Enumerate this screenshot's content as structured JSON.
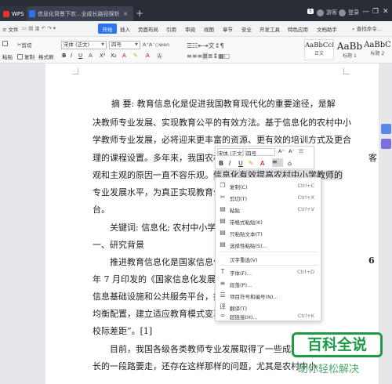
{
  "titlebar": {
    "app_tab": "WPS",
    "doc_tab": "信息化背景下农...业成长路径探析",
    "close": "×",
    "new_tab": "+",
    "badge": "5",
    "guest": "游客",
    "login": "登录",
    "minimize": "—",
    "maximize": "❐",
    "window_close": "✕"
  },
  "menubar": {
    "file": "文件",
    "start": "开始",
    "items": [
      "插入",
      "页面布局",
      "引用",
      "审阅",
      "视图",
      "章节",
      "安全",
      "开发工具",
      "特色应用",
      "文档助手"
    ],
    "search": "查找命令..."
  },
  "ribbon": {
    "cut": "剪切",
    "copy": "复制",
    "paste": "粘贴",
    "format_painter": "格式刷",
    "font_name": "宋体 (正文)",
    "font_size": "四号",
    "styles": [
      {
        "preview": "AaBbCcDd",
        "name": "正文"
      },
      {
        "preview": "AaBb",
        "name": "标题 1"
      },
      {
        "preview": "AaBbC",
        "name": "标题 2"
      }
    ]
  },
  "document": {
    "lines": [
      "摘    要:   教育信息化是促进我国教育现代化的重要途径，是解",
      "决教师专业发展、实现教育公平的有效方法。基于信息化的农村中小",
      "学教师专业发展，必将迎来更丰富的资源、更有效的培训方式及更合",
      "理的课程设置。多年来，我国农村中",
      "观和主观的原因一直不容乐观。",
      "专业发展水平，为真正实现教育公",
      "台。",
      "关键词:    信息化; 农村中小学",
      "一、研究背景",
      "推进教育信息化是国家信息化",
      "年 7 月印发的《国家信息化发展战",
      "信息基础设施和公共服务平台，推",
      "均衡配置，建立适应教育模式变革的",
      "校际差距”。[1]",
      "目前，我国各级各类教师专业发展取得了一些成就，但",
      "长的一段路要走，还存在这样那样的问题，尤其是农村中小"
    ],
    "line4_selected": "信息化有效提高农村中小学教师的",
    "line3_suffix": "客",
    "num_6": "6"
  },
  "mini_toolbar": {
    "font_name": "宋体 (正文)",
    "font_size": "四号",
    "grow": "A⁺",
    "shrink": "A⁻",
    "bold": "B",
    "italic": "I",
    "underline": "U"
  },
  "context_menu": {
    "items": [
      {
        "label": "复制(C)",
        "shortcut": "Ctrl+C"
      },
      {
        "label": "剪切(T)",
        "shortcut": "Ctrl+X"
      },
      {
        "label": "粘贴",
        "shortcut": "Ctrl+V"
      },
      {
        "label": "带格式粘贴(K)",
        "shortcut": ""
      },
      {
        "label": "只粘贴文本(T)",
        "shortcut": ""
      },
      {
        "label": "选择性粘贴(S)...",
        "shortcut": ""
      },
      {
        "label": "汉字重选(V)",
        "shortcut": ""
      },
      {
        "label": "字体(F)...",
        "shortcut": "Ctrl+D"
      },
      {
        "label": "段落(P)...",
        "shortcut": ""
      },
      {
        "label": "项目符号和编号(N)...",
        "shortcut": ""
      },
      {
        "label": "翻译(T)",
        "shortcut": ""
      },
      {
        "label": "超链接(H)...",
        "shortcut": "Ctrl+K"
      }
    ]
  },
  "watermark": {
    "logo": "百科全说",
    "slogan": "助你轻松解决"
  }
}
